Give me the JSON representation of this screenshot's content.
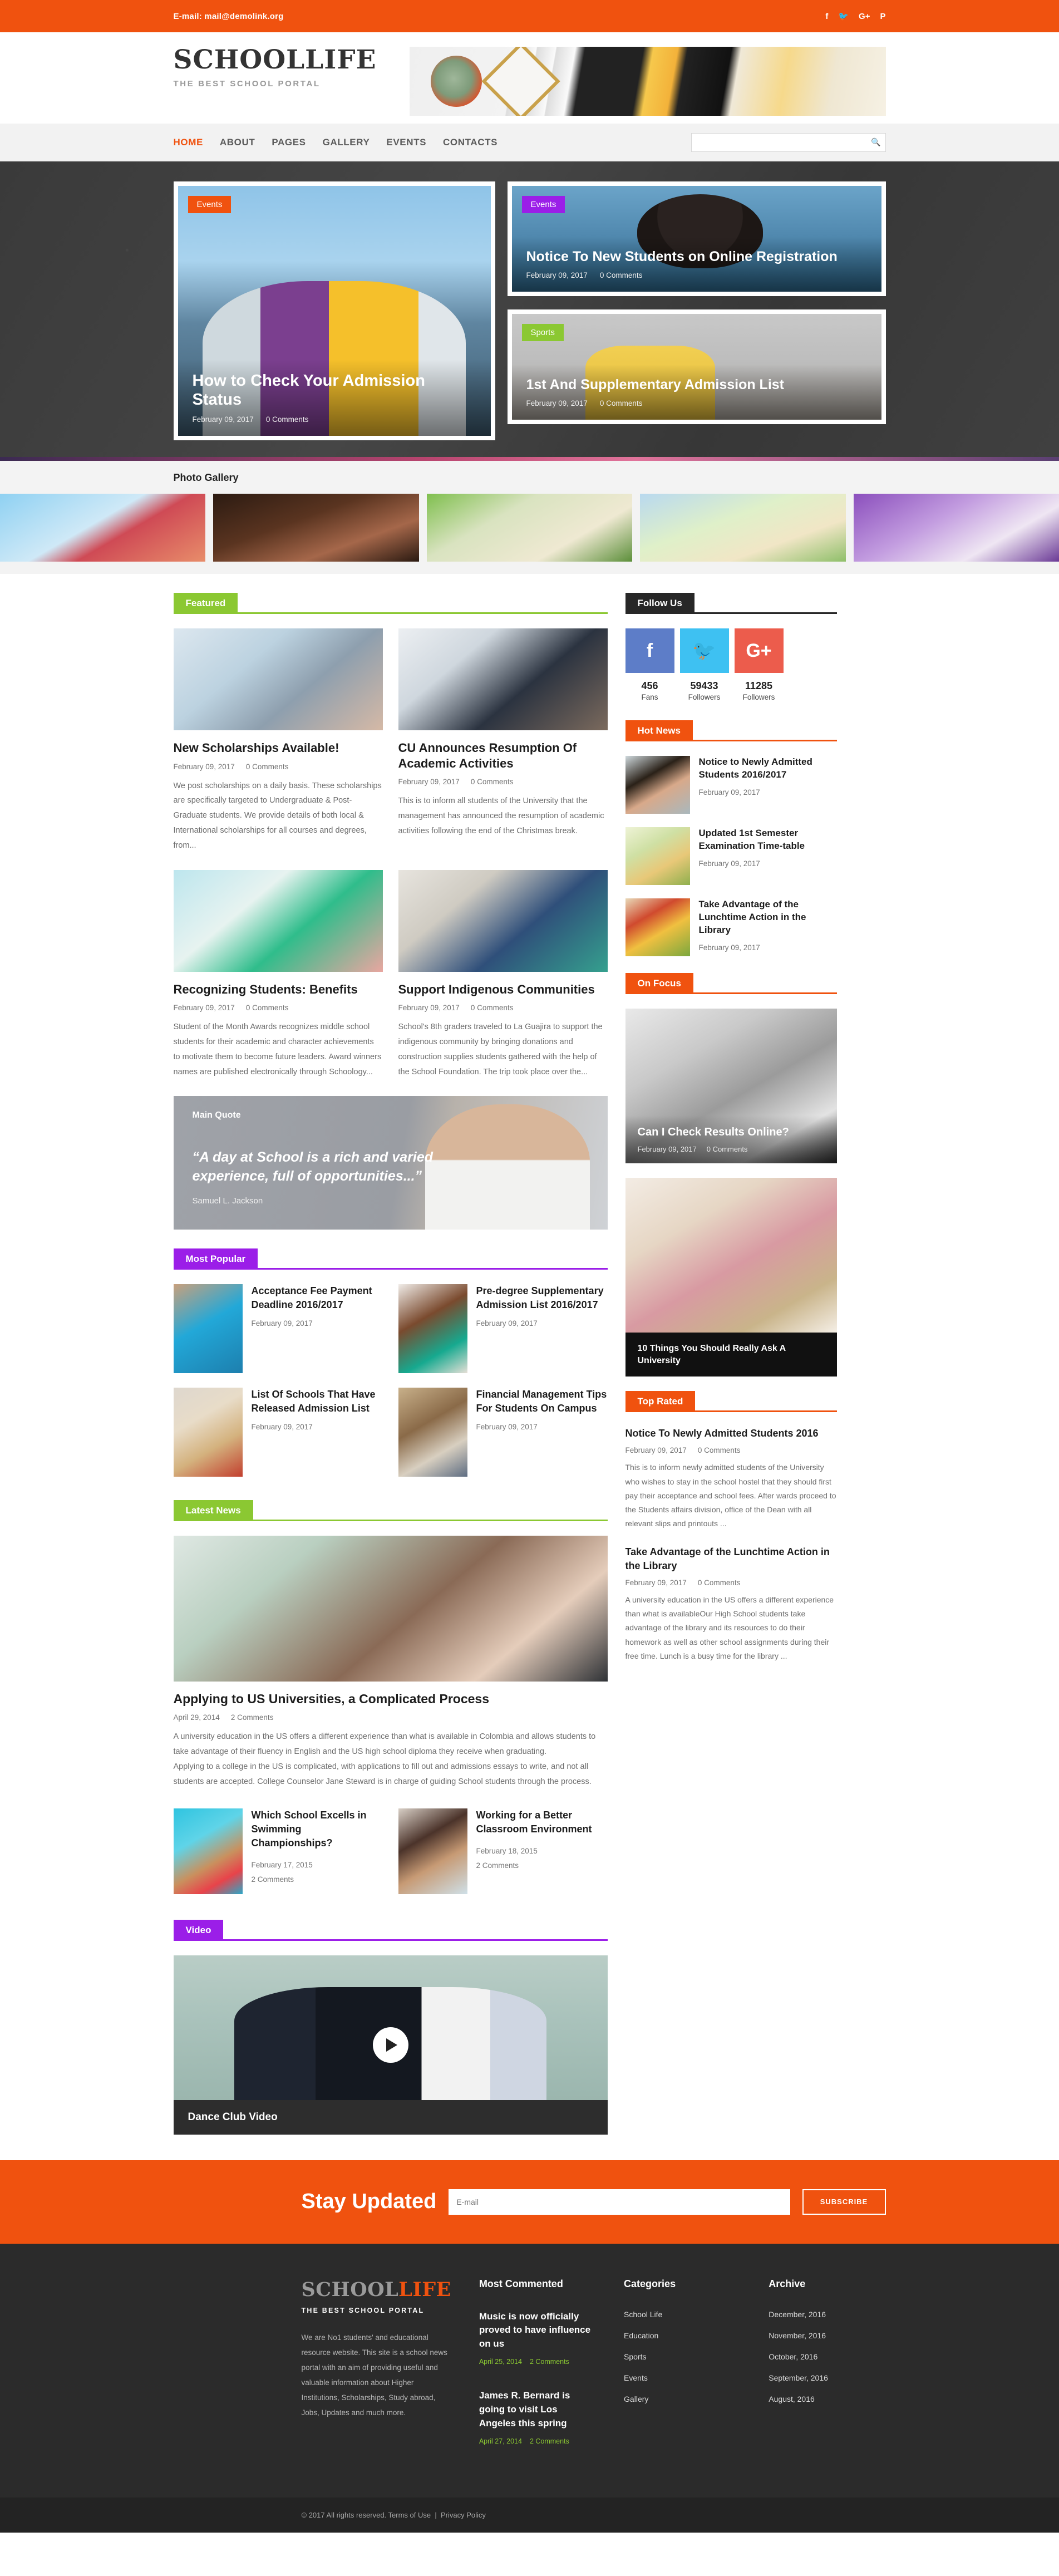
{
  "topbar": {
    "email": "E-mail: mail@demolink.org",
    "social": [
      "f",
      "𝐓",
      "G+",
      "P"
    ],
    "social_names": [
      "facebook",
      "twitter",
      "google-plus",
      "pinterest"
    ]
  },
  "header": {
    "brand_name": "SCHOOLLIFE",
    "brand_tagline": "THE BEST SCHOOL PORTAL"
  },
  "nav": {
    "items": [
      "HOME",
      "ABOUT",
      "PAGES",
      "GALLERY",
      "EVENTS",
      "CONTACTS"
    ],
    "active_index": 0,
    "search_placeholder": "",
    "search_value": ""
  },
  "hero": {
    "main": {
      "badge": "Events",
      "title": "How to Check Your Admission Status",
      "date": "February 09, 2017",
      "comments": "0 Comments"
    },
    "side": [
      {
        "badge": "Events",
        "title": "Notice To New Students on Online Registration",
        "date": "February 09, 2017",
        "comments": "0 Comments"
      },
      {
        "badge": "Sports",
        "title": "1st And Supplementary Admission List",
        "date": "February 09, 2017",
        "comments": "0 Comments"
      }
    ]
  },
  "gallery": {
    "title": "Photo Gallery",
    "items": [
      "gallery-photo-1",
      "gallery-photo-2",
      "gallery-photo-3",
      "gallery-photo-4",
      "gallery-photo-5"
    ]
  },
  "featured": {
    "label": "Featured",
    "posts": [
      {
        "title": "New Scholarships Available!",
        "date": "February 09, 2017",
        "comments": "0 Comments",
        "text": "We post scholarships on a daily basis. These scholarships are specifically targeted to Undergraduate & Post-Graduate students. We provide details of both local & International scholarships for all courses and degrees, from..."
      },
      {
        "title": "CU Announces Resumption Of Academic Activities",
        "date": "February 09, 2017",
        "comments": "0 Comments",
        "text": "This is to inform all students of the University that the management has announced the resumption of academic activities following the end of the Christmas break."
      },
      {
        "title": "Recognizing Students: Benefits",
        "date": "February 09, 2017",
        "comments": "0 Comments",
        "text": "Student of the Month Awards recognizes middle school students for their academic and character achievements to motivate them to become future leaders. Award winners names are published electronically through Schoology..."
      },
      {
        "title": "Support Indigenous Communities",
        "date": "February 09, 2017",
        "comments": "0 Comments",
        "text": "School's 8th graders traveled to La Guajira to support the indigenous community by bringing donations and construction supplies students gathered with the help of the School Foundation. The trip took place over the..."
      }
    ]
  },
  "quote": {
    "label": "Main Quote",
    "text": "“A day at School is a rich and varied experience, full of opportunities...”",
    "author": "Samuel L. Jackson"
  },
  "most_popular": {
    "label": "Most Popular",
    "items": [
      {
        "title": "Acceptance Fee Payment Deadline 2016/2017",
        "date": "February 09, 2017"
      },
      {
        "title": "Pre-degree Supplementary Admission List 2016/2017",
        "date": "February 09, 2017"
      },
      {
        "title": "List Of Schools That Have Released Admission List",
        "date": "February 09, 2017"
      },
      {
        "title": "Financial Management Tips For Students On Campus",
        "date": "February 09, 2017"
      }
    ]
  },
  "latest_news": {
    "label": "Latest News",
    "lead": {
      "title": "Applying to US Universities, a Complicated Process",
      "date": "April 29, 2014",
      "comments": "2 Comments",
      "paragraph1": "A university education in the US offers a different experience than what is available in Colombia and allows students to take advantage of their fluency in English and the US high school diploma they receive when graduating.",
      "paragraph2": "Applying to a college in the US is complicated, with applications to fill out and admissions essays to write, and not all students are accepted. College Counselor Jane Steward is in charge of guiding School students through the process."
    },
    "subposts": [
      {
        "title": "Which School Excells in Swimming Championships?",
        "date": "February 17, 2015",
        "comments": "2 Comments"
      },
      {
        "title": "Working for a Better Classroom Environment",
        "date": "February 18, 2015",
        "comments": "2 Comments"
      }
    ]
  },
  "video": {
    "label": "Video",
    "caption": "Dance Club Video",
    "play_icon": "play-icon"
  },
  "sidebar": {
    "follow": {
      "label": "Follow Us",
      "networks": [
        {
          "icon": "f",
          "name": "facebook",
          "count": "456",
          "label": "Fans"
        },
        {
          "icon": "✈",
          "name": "twitter",
          "count": "59433",
          "label": "Followers"
        },
        {
          "icon": "G+",
          "name": "google-plus",
          "count": "11285",
          "label": "Followers"
        }
      ]
    },
    "hot_news": {
      "label": "Hot News",
      "items": [
        {
          "title": "Notice to Newly Admitted Students 2016/2017",
          "date": "February 09, 2017"
        },
        {
          "title": "Updated 1st Semester Examination Time-table",
          "date": "February 09, 2017"
        },
        {
          "title": "Take Advantage of the Lunchtime Action in the Library",
          "date": "February 09, 2017"
        }
      ]
    },
    "on_focus": {
      "label": "On Focus",
      "card1": {
        "title": "Can I Check Results Online?",
        "date": "February 09, 2017",
        "comments": "0 Comments"
      },
      "card2": {
        "caption": "10 Things You Should Really Ask A University"
      }
    },
    "top_rated": {
      "label": "Top Rated",
      "items": [
        {
          "title": "Notice To Newly Admitted Students 2016",
          "date": "February 09, 2017",
          "comments": "0 Comments",
          "text": "This is to inform newly admitted students of the University who wishes to stay in the school hostel that they should first pay their acceptance and school fees. After wards proceed to the Students affairs division, office of the Dean with all relevant slips and printouts ..."
        },
        {
          "title": "Take Advantage of the Lunchtime Action in the Library",
          "date": "February 09, 2017",
          "comments": "0 Comments",
          "text": "A university education in the US offers a different experience than what is availableOur High School students take advantage of the library and its resources to do their homework as well as other school assignments during their free time. Lunch is a busy time for the library ..."
        }
      ]
    }
  },
  "subscribe": {
    "title": "Stay Updated",
    "placeholder": "E-mail",
    "value": "",
    "button": "SUBSCRIBE"
  },
  "footer": {
    "logo_part1": "SCHOOL",
    "logo_part2": "LIFE",
    "tagline": "THE BEST SCHOOL PORTAL",
    "about": "We are No1 students' and educational resource website. This site is a school news portal with an aim of providing useful and valuable information about Higher Institutions, Scholarships, Study abroad, Jobs, Updates and much more.",
    "most_commented": {
      "heading": "Most Commented",
      "posts": [
        {
          "title": "Music is now officially proved to have influence on us",
          "date": "April 25, 2014",
          "comments": "2 Comments"
        },
        {
          "title": "James R. Bernard is going to visit Los Angeles this spring",
          "date": "April 27, 2014",
          "comments": "2 Comments"
        }
      ]
    },
    "categories": {
      "heading": "Categories",
      "items": [
        "School Life",
        "Education",
        "Sports",
        "Events",
        "Gallery"
      ]
    },
    "archive": {
      "heading": "Archive",
      "items": [
        "December, 2016",
        "November, 2016",
        "October, 2016",
        "September, 2016",
        "August, 2016"
      ]
    },
    "copyright": "© 2017 All rights reserved. Terms of Use",
    "separator": "|",
    "privacy": "Privacy Policy"
  },
  "colors": {
    "accent_orange": "#f0520f",
    "green": "#8bc832",
    "purple": "#9b1ee8",
    "dark": "#272727"
  }
}
